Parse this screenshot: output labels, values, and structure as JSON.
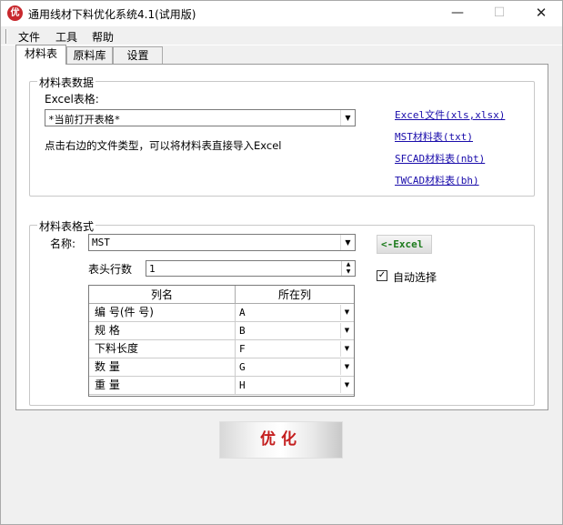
{
  "window": {
    "title": "通用线材下料优化系统4.1(试用版)",
    "icon_text": "优",
    "minimize": "—",
    "maximize": "☐",
    "close": "✕"
  },
  "menu": [
    "文件",
    "工具",
    "帮助"
  ],
  "tabs": [
    "材料表",
    "原料库",
    "设置"
  ],
  "data_group": {
    "title": "材料表数据",
    "excel_label": "Excel表格:",
    "excel_value": "*当前打开表格*",
    "hint": "点击右边的文件类型，可以将材料表直接导入Excel",
    "links": [
      "Excel文件(xls,xlsx)",
      "MST材料表(txt)",
      "SFCAD材料表(nbt)",
      "TWCAD材料表(bh)"
    ]
  },
  "format_group": {
    "title": "材料表格式",
    "name_label": "名称:",
    "name_value": "MST",
    "excel_button": "<-Excel",
    "auto_select_label": "自动选择",
    "auto_select_checked": true,
    "header_rows_label": "表头行数",
    "header_rows_value": "1",
    "grid": {
      "columns": [
        "列名",
        "所在列"
      ],
      "rows": [
        {
          "name": "编 号(件 号)",
          "col": "A"
        },
        {
          "name": "规 格",
          "col": "B"
        },
        {
          "name": "下料长度",
          "col": "F"
        },
        {
          "name": "数 量",
          "col": "G"
        },
        {
          "name": "重 量",
          "col": "H"
        }
      ]
    }
  },
  "optimize_button": "优化"
}
